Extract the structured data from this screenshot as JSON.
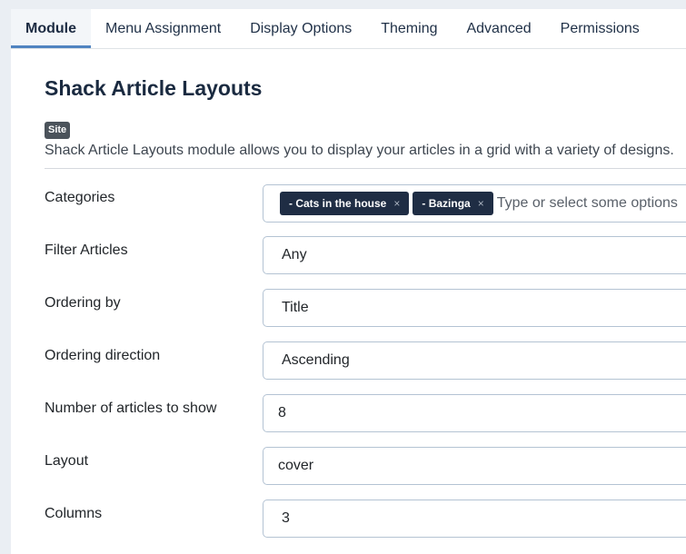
{
  "tabs": [
    {
      "label": "Module",
      "active": true
    },
    {
      "label": "Menu Assignment",
      "active": false
    },
    {
      "label": "Display Options",
      "active": false
    },
    {
      "label": "Theming",
      "active": false
    },
    {
      "label": "Advanced",
      "active": false
    },
    {
      "label": "Permissions",
      "active": false
    }
  ],
  "module": {
    "title": "Shack Article Layouts",
    "badge": "Site",
    "description": "Shack Article Layouts module allows you to display your articles in a grid with a variety of designs."
  },
  "fields": {
    "categories": {
      "label": "Categories",
      "chips": [
        "- Cats in the house",
        "- Bazinga"
      ],
      "remove_glyph": "×",
      "placeholder": "Type or select some options"
    },
    "filter_articles": {
      "label": "Filter Articles",
      "value": "Any"
    },
    "ordering_by": {
      "label": "Ordering by",
      "value": "Title"
    },
    "ordering_direction": {
      "label": "Ordering direction",
      "value": "Ascending"
    },
    "number_of_articles": {
      "label": "Number of articles to show",
      "value": "8"
    },
    "layout": {
      "label": "Layout",
      "value": "cover"
    },
    "columns": {
      "label": "Columns",
      "value": "3"
    }
  }
}
